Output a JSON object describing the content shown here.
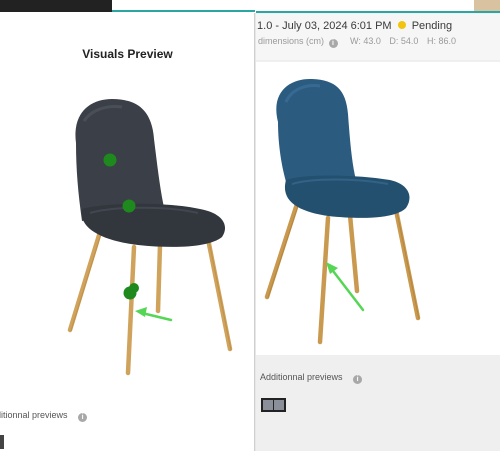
{
  "left_panel": {
    "title": "Visuals Preview",
    "additional_previews_label": "ditionnal previews",
    "chair_color": "#3b3f47",
    "marker_color": "#1e8a1e",
    "arrow_color": "#55d655"
  },
  "right_panel": {
    "version_text": ".1.0 - July 03, 2024 6:01 PM",
    "status": "Pending",
    "status_color": "#f1c40f",
    "dimensions_label": "dimensions (cm)",
    "width": "W: 43.0",
    "depth": "D: 54.0",
    "height": "H: 86.0",
    "additional_previews_label": "Additionnal previews",
    "chair_color": "#2c5b80",
    "arrow_color": "#55d655"
  },
  "icons": {
    "info": "info-icon",
    "status": "status-dot-icon"
  }
}
